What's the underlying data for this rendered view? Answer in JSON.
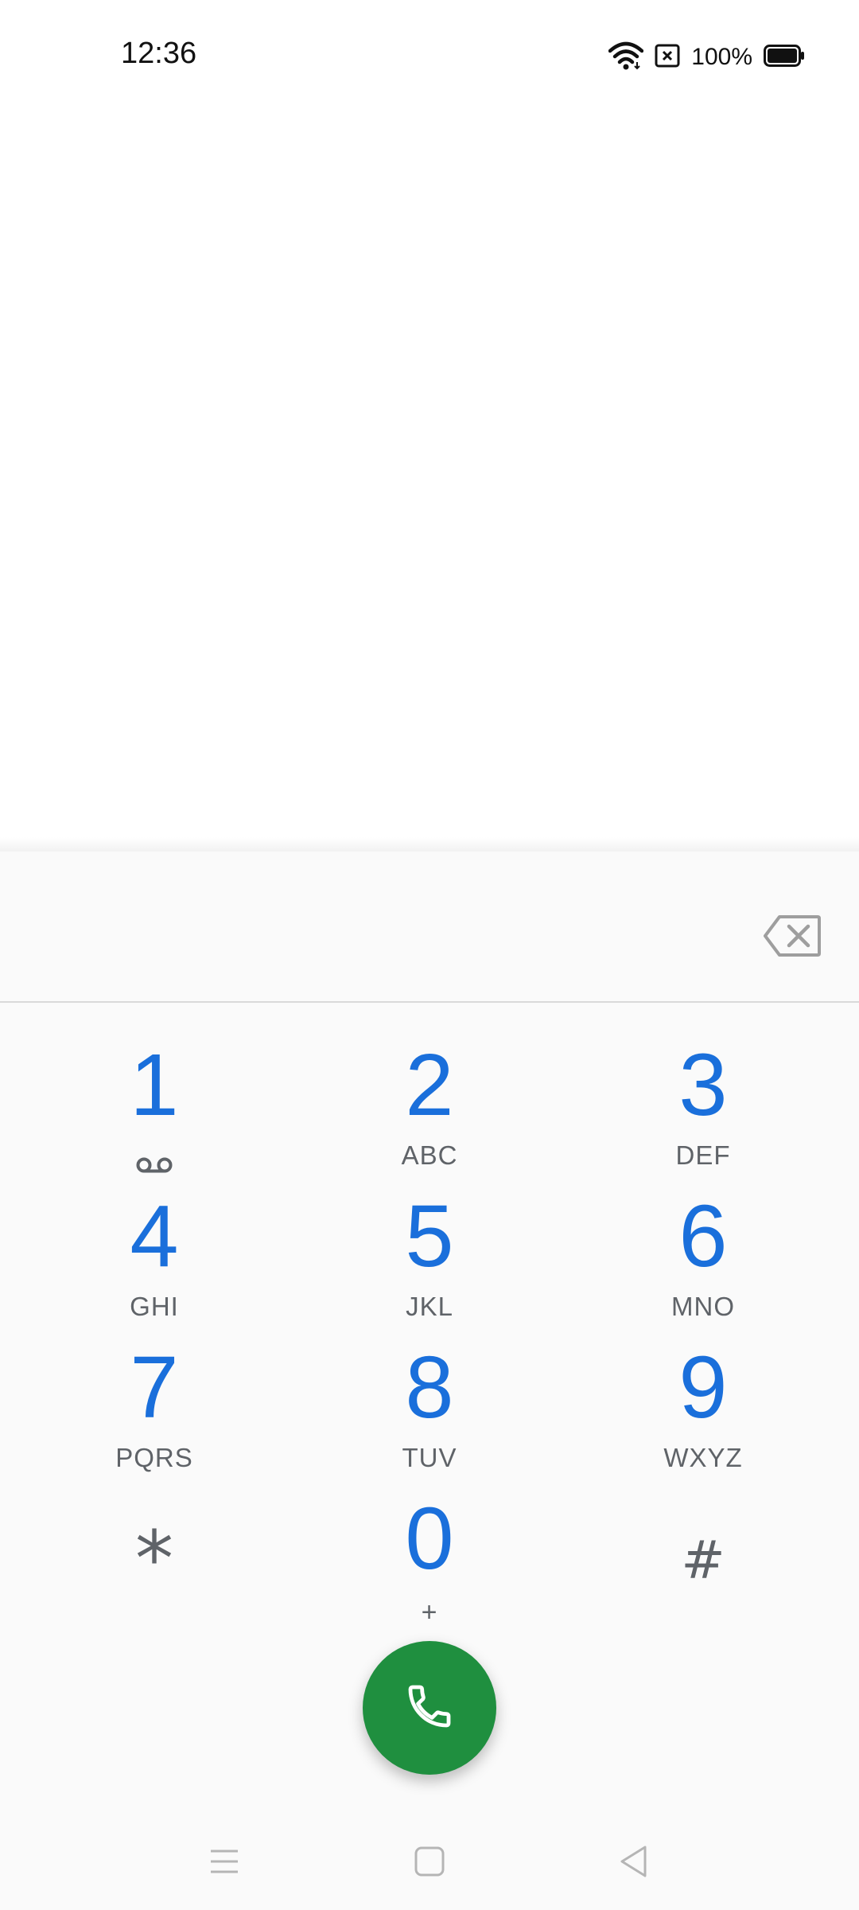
{
  "status_bar": {
    "time": "12:36",
    "battery_percent": "100%",
    "icons": [
      "wifi-icon",
      "sim-card-icon",
      "battery-icon"
    ]
  },
  "dialer": {
    "input_value": "",
    "backspace_icon": "backspace-icon",
    "keys": [
      {
        "digit": "1",
        "letters": "",
        "sub_icon": "voicemail-icon"
      },
      {
        "digit": "2",
        "letters": "ABC"
      },
      {
        "digit": "3",
        "letters": "DEF"
      },
      {
        "digit": "4",
        "letters": "GHI"
      },
      {
        "digit": "5",
        "letters": "JKL"
      },
      {
        "digit": "6",
        "letters": "MNO"
      },
      {
        "digit": "7",
        "letters": "PQRS"
      },
      {
        "digit": "8",
        "letters": "TUV"
      },
      {
        "digit": "9",
        "letters": "WXYZ"
      },
      {
        "digit": "*",
        "letters": ""
      },
      {
        "digit": "0",
        "letters": "+"
      },
      {
        "digit": "#",
        "letters": ""
      }
    ],
    "call_icon": "phone-icon"
  },
  "nav_bar": {
    "buttons": [
      "menu-icon",
      "home-icon",
      "back-icon"
    ]
  },
  "colors": {
    "digit": "#1a6fdb",
    "letters": "#5f6368",
    "call_button": "#1f8f3f",
    "sheet_background": "#fafafa"
  }
}
